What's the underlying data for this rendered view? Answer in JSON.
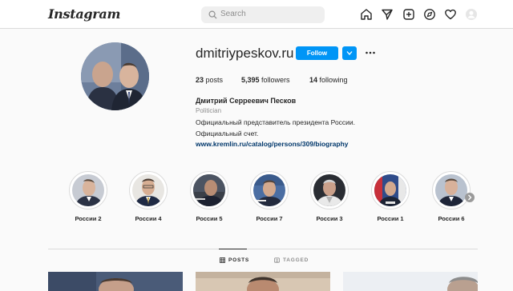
{
  "nav": {
    "logo": "Instagram",
    "search_placeholder": "Search"
  },
  "profile": {
    "username": "dmitriypeskov.ru",
    "follow_label": "Follow",
    "stats": {
      "posts_count": "23",
      "posts_label": "posts",
      "followers_count": "5,395",
      "followers_label": "followers",
      "following_count": "14",
      "following_label": "following"
    },
    "full_name": "Дмитрий Серреевич Песков",
    "category": "Politician",
    "bio_line1": "Официальный представитель президента России.",
    "bio_line2": "Официальный счет.",
    "link": "www.kremlin.ru/catalog/persons/309/biography"
  },
  "highlights": [
    {
      "label": "России 2"
    },
    {
      "label": "России 4"
    },
    {
      "label": "России 5"
    },
    {
      "label": "России 7"
    },
    {
      "label": "России 3"
    },
    {
      "label": "России 1"
    },
    {
      "label": "России 6"
    }
  ],
  "tabs": {
    "posts": "POSTS",
    "tagged": "TAGGED"
  },
  "colors": {
    "accent": "#0095f6",
    "link": "#00376b",
    "border": "#dbdbdb",
    "background": "#fafafa"
  },
  "icons": [
    "search-icon",
    "home-icon",
    "direct-icon",
    "new-post-icon",
    "explore-icon",
    "activity-heart-icon",
    "profile-avatar-icon",
    "chevron-down-icon",
    "more-dots-icon",
    "grid-icon",
    "tag-icon",
    "chevron-right-icon"
  ]
}
